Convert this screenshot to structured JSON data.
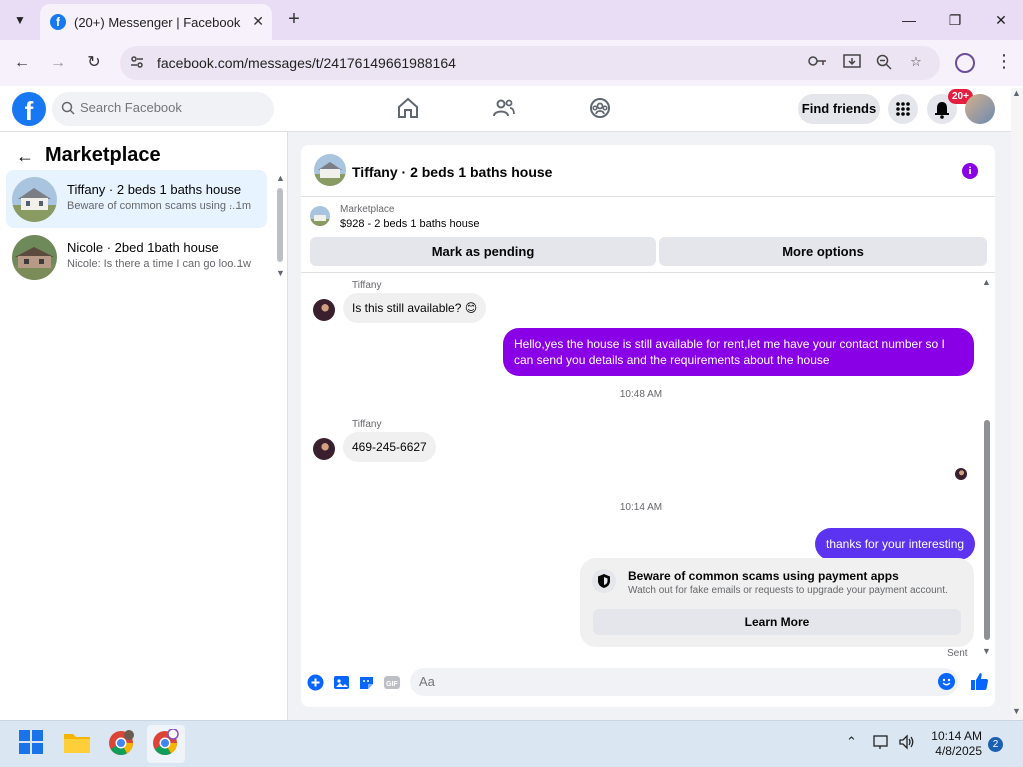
{
  "browser": {
    "tab_title": "(20+) Messenger | Facebook",
    "url": "facebook.com/messages/t/24176149661988164"
  },
  "fb": {
    "search_placeholder": "Search Facebook",
    "find_friends": "Find friends",
    "notification_badge": "20+"
  },
  "sidebar": {
    "title": "Marketplace",
    "conversations": [
      {
        "name": "Tiffany · 2 beds 1 baths house",
        "preview": "Beware of common scams using ...",
        "time": "· 1m"
      },
      {
        "name": "Nicole · 2bed 1bath house",
        "preview": "Nicole: Is there a time I can go loo...",
        "time": "· 1w"
      }
    ]
  },
  "chat": {
    "title": "Tiffany · 2 beds 1 baths house",
    "marketplace_label": "Marketplace",
    "listing": "$928 - 2 beds 1 baths house",
    "mark_pending": "Mark as pending",
    "more_options": "More options",
    "messages": {
      "sender1": "Tiffany",
      "msg1": "Is this still available? 😊",
      "reply1": "Hello,yes the house is still available for rent,let me have your contact number so I can send you details and the requirements about the house",
      "time1": "10:48 AM",
      "sender2": "Tiffany",
      "msg2": "469-245-6627",
      "time2": "10:14 AM",
      "reply2": "thanks for your interesting",
      "sent": "Sent"
    },
    "scam_card": {
      "title": "Beware of common scams using payment apps",
      "desc": "Watch out for fake emails or requests to upgrade your payment account.",
      "button": "Learn More"
    },
    "composer_placeholder": "Aa"
  },
  "taskbar": {
    "time": "10:14 AM",
    "date": "4/8/2025",
    "notifications": "2"
  },
  "colors": {
    "fb_blue": "#1877f2",
    "outgoing_bubble": "#8a00e6",
    "incoming_bubble": "#f0f0f0",
    "browser_frame": "#e9ddf5"
  }
}
